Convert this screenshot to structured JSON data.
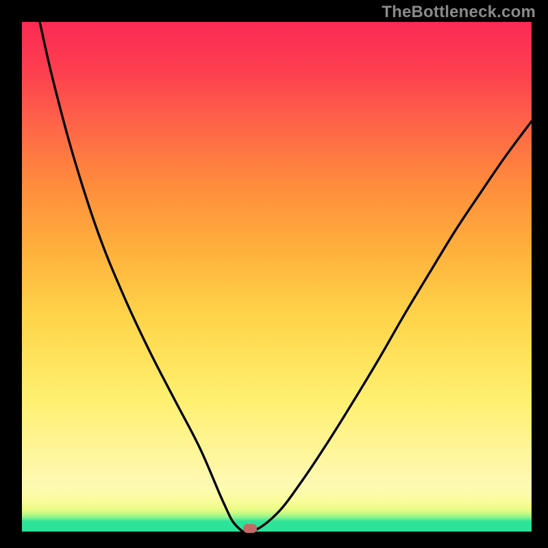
{
  "watermark": "TheBottleneck.com",
  "marker": {
    "x_fraction": 0.448,
    "y_fraction": 0.0
  },
  "chart_data": {
    "type": "line",
    "title": "",
    "xlabel": "",
    "ylabel": "",
    "xlim": [
      0,
      1
    ],
    "ylim": [
      0,
      1
    ],
    "series": [
      {
        "name": "curve",
        "x": [
          0.035,
          0.06,
          0.1,
          0.15,
          0.2,
          0.25,
          0.3,
          0.35,
          0.395,
          0.42,
          0.45,
          0.5,
          0.55,
          0.6,
          0.65,
          0.7,
          0.75,
          0.8,
          0.85,
          0.9,
          0.95,
          1.0
        ],
        "y": [
          1.0,
          0.89,
          0.74,
          0.585,
          0.462,
          0.355,
          0.258,
          0.162,
          0.058,
          0.012,
          0.0,
          0.035,
          0.1,
          0.175,
          0.255,
          0.338,
          0.425,
          0.508,
          0.59,
          0.665,
          0.738,
          0.805
        ]
      }
    ]
  },
  "colors": {
    "background": "#000000",
    "gradient_top": "#fb2a55",
    "gradient_bottom": "#2de39a",
    "curve": "#000000",
    "marker": "#c46a66",
    "watermark": "#8a8a8a"
  }
}
